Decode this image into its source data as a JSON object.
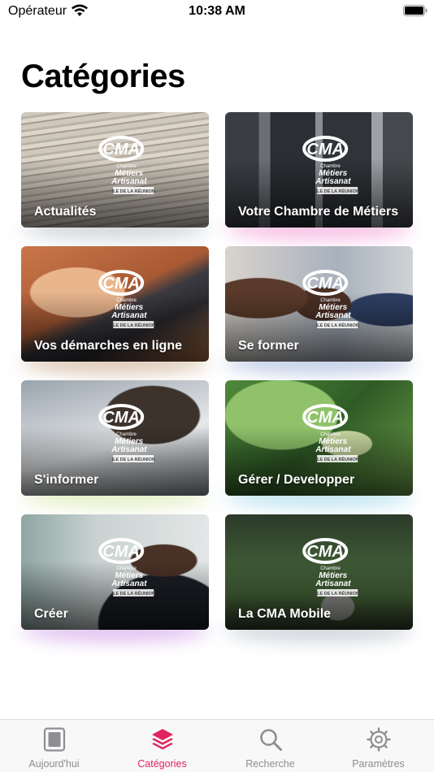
{
  "status_bar": {
    "carrier": "Opérateur",
    "time": "10:38 AM"
  },
  "page_title": "Catégories",
  "logo": {
    "line1": "Chambre",
    "line2": "Métiers",
    "line3": "Artisanat",
    "badge": "ILE DE LA RÉUNION"
  },
  "categories": [
    {
      "label": "Actualités",
      "photo": "newspaper-stack",
      "glow": "#b9c0c8"
    },
    {
      "label": "Votre Chambre de Métiers",
      "photo": "office-entrance",
      "glow": "#f39bd6"
    },
    {
      "label": "Vos démarches en ligne",
      "photo": "hands-tablet",
      "glow": "#c9a98a"
    },
    {
      "label": "Se former",
      "photo": "students-group",
      "glow": "#9fb2d8"
    },
    {
      "label": "S'informer",
      "photo": "signing-paper",
      "glow": "#d8e7a9"
    },
    {
      "label": "Gérer / Developper",
      "photo": "coins-plant",
      "glow": "#9fd7e8"
    },
    {
      "label": "Créer",
      "photo": "businessman-office",
      "glow": "#cf9ee8"
    },
    {
      "label": "La CMA Mobile",
      "photo": "forest-road",
      "glow": "#b7bfc8"
    }
  ],
  "tabs": [
    {
      "label": "Aujourd'hui",
      "icon": "today-icon",
      "active": false
    },
    {
      "label": "Catégories",
      "icon": "layers-icon",
      "active": true
    },
    {
      "label": "Recherche",
      "icon": "search-icon",
      "active": false
    },
    {
      "label": "Paramètres",
      "icon": "gear-icon",
      "active": false
    }
  ],
  "colors": {
    "accent": "#e0245e",
    "tab_inactive": "#8e8e93"
  }
}
